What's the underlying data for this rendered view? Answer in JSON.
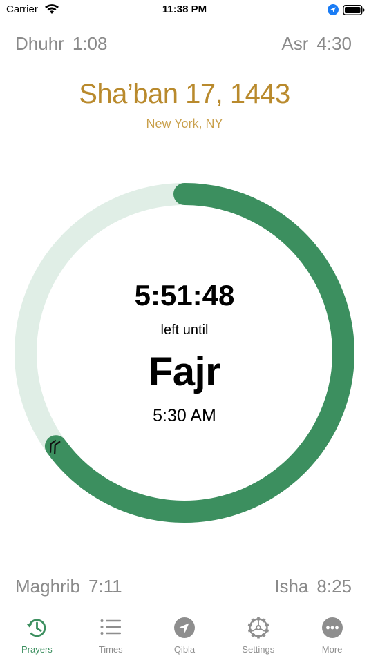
{
  "status_bar": {
    "carrier": "Carrier",
    "time": "11:38 PM",
    "icons": [
      "wifi-icon",
      "location-icon",
      "battery-icon"
    ]
  },
  "prayers": {
    "top_left": {
      "name": "Dhuhr",
      "time": "1:08"
    },
    "top_right": {
      "name": "Asr",
      "time": "4:30"
    },
    "bottom_left": {
      "name": "Maghrib",
      "time": "7:11"
    },
    "bottom_right": {
      "name": "Isha",
      "time": "8:25"
    }
  },
  "header": {
    "hijri_date": "Sha’ban 17, 1443",
    "location": "New York, NY"
  },
  "countdown": {
    "remaining": "5:51:48",
    "caption": "left until",
    "next_prayer": "Fajr",
    "next_prayer_time": "5:30 AM",
    "progress_fraction": 0.65
  },
  "colors": {
    "ring_active": "#3c8f5f",
    "ring_track": "#e0eee6",
    "date_gold": "#b98a2d",
    "muted_gray": "#8a8a8a"
  },
  "tabs": [
    {
      "label": "Prayers",
      "icon": "history-clock-icon",
      "active": true
    },
    {
      "label": "Times",
      "icon": "list-icon",
      "active": false
    },
    {
      "label": "Qibla",
      "icon": "compass-arrow-icon",
      "active": false
    },
    {
      "label": "Settings",
      "icon": "gear-icon",
      "active": false
    },
    {
      "label": "More",
      "icon": "ellipsis-icon",
      "active": false
    }
  ]
}
